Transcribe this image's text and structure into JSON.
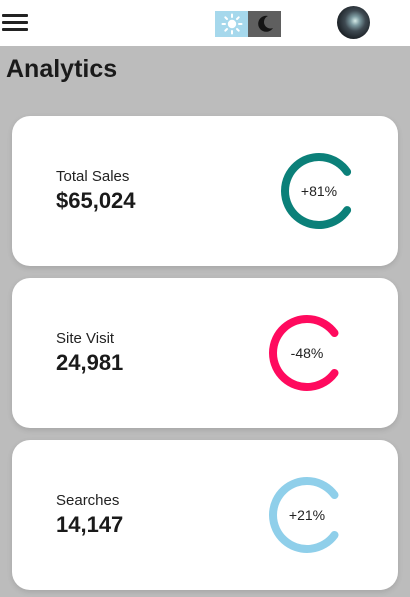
{
  "header": {
    "menu_icon": "hamburger-menu-icon",
    "light_icon": "sun-icon",
    "dark_icon": "moon-icon",
    "avatar": "user-avatar"
  },
  "page": {
    "title": "Analytics"
  },
  "cards": [
    {
      "label": "Total Sales",
      "value": "$65,024",
      "change": "+81%",
      "color": "#0b8079",
      "progress": 0.81
    },
    {
      "label": "Site Visit",
      "value": "24,981",
      "change": "-48%",
      "color": "#ff0a5e",
      "progress": 0.8
    },
    {
      "label": "Searches",
      "value": "14,147",
      "change": "+21%",
      "color": "#8fcfea",
      "progress": 0.8
    }
  ],
  "colors": {
    "background": "#bcbcbc",
    "light_toggle": "#a6d8ec",
    "dark_toggle": "#5f5f5f"
  }
}
